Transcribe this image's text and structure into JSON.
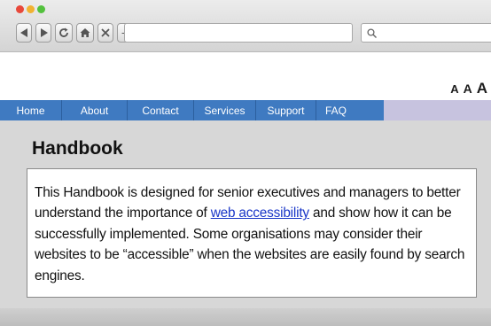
{
  "browser": {
    "new_tab_label": "+",
    "url_value": "",
    "search_value": ""
  },
  "font_size_controls": [
    "A",
    "A",
    "A"
  ],
  "menu": [
    {
      "label": "Home",
      "w": 0
    },
    {
      "label": "About"
    },
    {
      "label": "Contact"
    },
    {
      "label": "Services"
    },
    {
      "label": "Support"
    },
    {
      "label": "FAQ"
    }
  ],
  "page": {
    "title": "Handbook",
    "body_before_link": "This Handbook is designed for senior executives and managers to better understand the importance of ",
    "link_text": "web accessibility",
    "body_after_link": " and show how it can be successfully implemented. Some organisations may consider their websites to be “accessible” when the websites are easily found by search engines."
  },
  "colors": {
    "menu_bg": "#3f7ac1",
    "link": "#1a37c8",
    "content_bg": "#d7d7d7"
  }
}
